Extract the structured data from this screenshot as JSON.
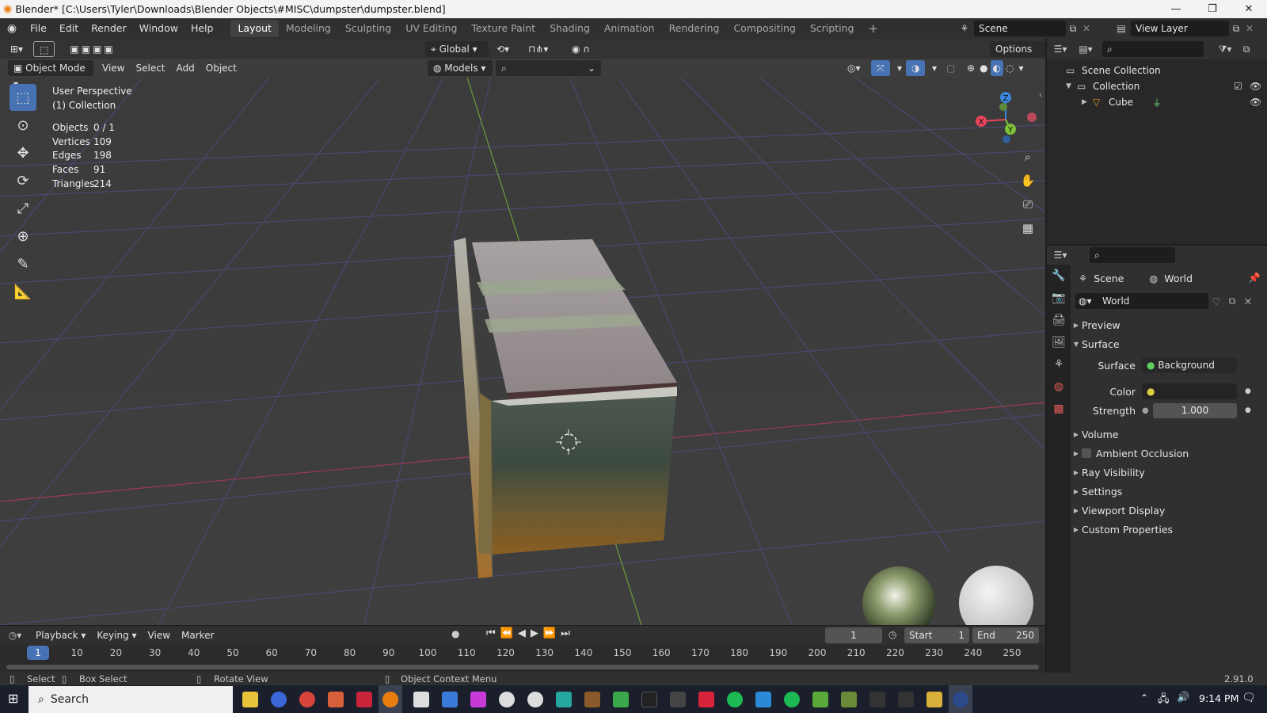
{
  "window": {
    "title": "Blender* [C:\\Users\\Tyler\\Downloads\\Blender Objects\\#MISC\\dumpster\\dumpster.blend]",
    "minimize": "—",
    "restore": "❐",
    "close": "✕"
  },
  "menu": [
    "File",
    "Edit",
    "Render",
    "Window",
    "Help"
  ],
  "workspaces": [
    "Layout",
    "Modeling",
    "Sculpting",
    "UV Editing",
    "Texture Paint",
    "Shading",
    "Animation",
    "Rendering",
    "Compositing",
    "Scripting"
  ],
  "scene": {
    "name": "Scene",
    "view_layer": "View Layer"
  },
  "viewport": {
    "orientation": "Global",
    "options_label": "Options",
    "mode": "Object Mode",
    "header_menus": [
      "View",
      "Select",
      "Add",
      "Object"
    ],
    "collection_filter": "Models",
    "overlay_title": "User Perspective",
    "overlay_collection": "(1) Collection",
    "stats": [
      {
        "label": "Objects",
        "value": "0 / 1"
      },
      {
        "label": "Vertices",
        "value": "109"
      },
      {
        "label": "Edges",
        "value": "198"
      },
      {
        "label": "Faces",
        "value": "91"
      },
      {
        "label": "Triangles",
        "value": "214"
      }
    ],
    "gizmo_axes": {
      "x": "X",
      "y": "Y",
      "z": "Z"
    }
  },
  "outliner": {
    "root": "Scene Collection",
    "collection": "Collection",
    "object": "Cube"
  },
  "properties": {
    "breadcrumb_scene": "Scene",
    "breadcrumb_world": "World",
    "world_name": "World",
    "panels": {
      "preview": "Preview",
      "surface": "Surface",
      "volume": "Volume",
      "ambient_occlusion": "Ambient Occlusion",
      "ray_visibility": "Ray Visibility",
      "settings": "Settings",
      "viewport_display": "Viewport Display",
      "custom_properties": "Custom Properties"
    },
    "surface_label": "Surface",
    "surface_value": "Background",
    "color_label": "Color",
    "strength_label": "Strength",
    "strength_value": "1.000"
  },
  "timeline": {
    "menus": [
      "Playback",
      "Keying",
      "View",
      "Marker"
    ],
    "current_frame": "1",
    "start_label": "Start",
    "start_value": "1",
    "end_label": "End",
    "end_value": "250",
    "ruler": [
      "1",
      "10",
      "20",
      "30",
      "40",
      "50",
      "60",
      "70",
      "80",
      "90",
      "100",
      "110",
      "120",
      "130",
      "140",
      "150",
      "160",
      "170",
      "180",
      "190",
      "200",
      "210",
      "220",
      "230",
      "240",
      "250"
    ]
  },
  "statusbar": {
    "select": "Select",
    "box_select": "Box Select",
    "rotate_view": "Rotate View",
    "context_menu": "Object Context Menu",
    "version": "2.91.0"
  },
  "taskbar": {
    "search_placeholder": "Search",
    "time": "9:14 PM"
  },
  "colors": {
    "accent": "#4772b3",
    "x_axis": "#e8455a",
    "y_axis": "#7ec23a",
    "z_axis": "#3b86e0",
    "object_orange": "#e0902e"
  }
}
